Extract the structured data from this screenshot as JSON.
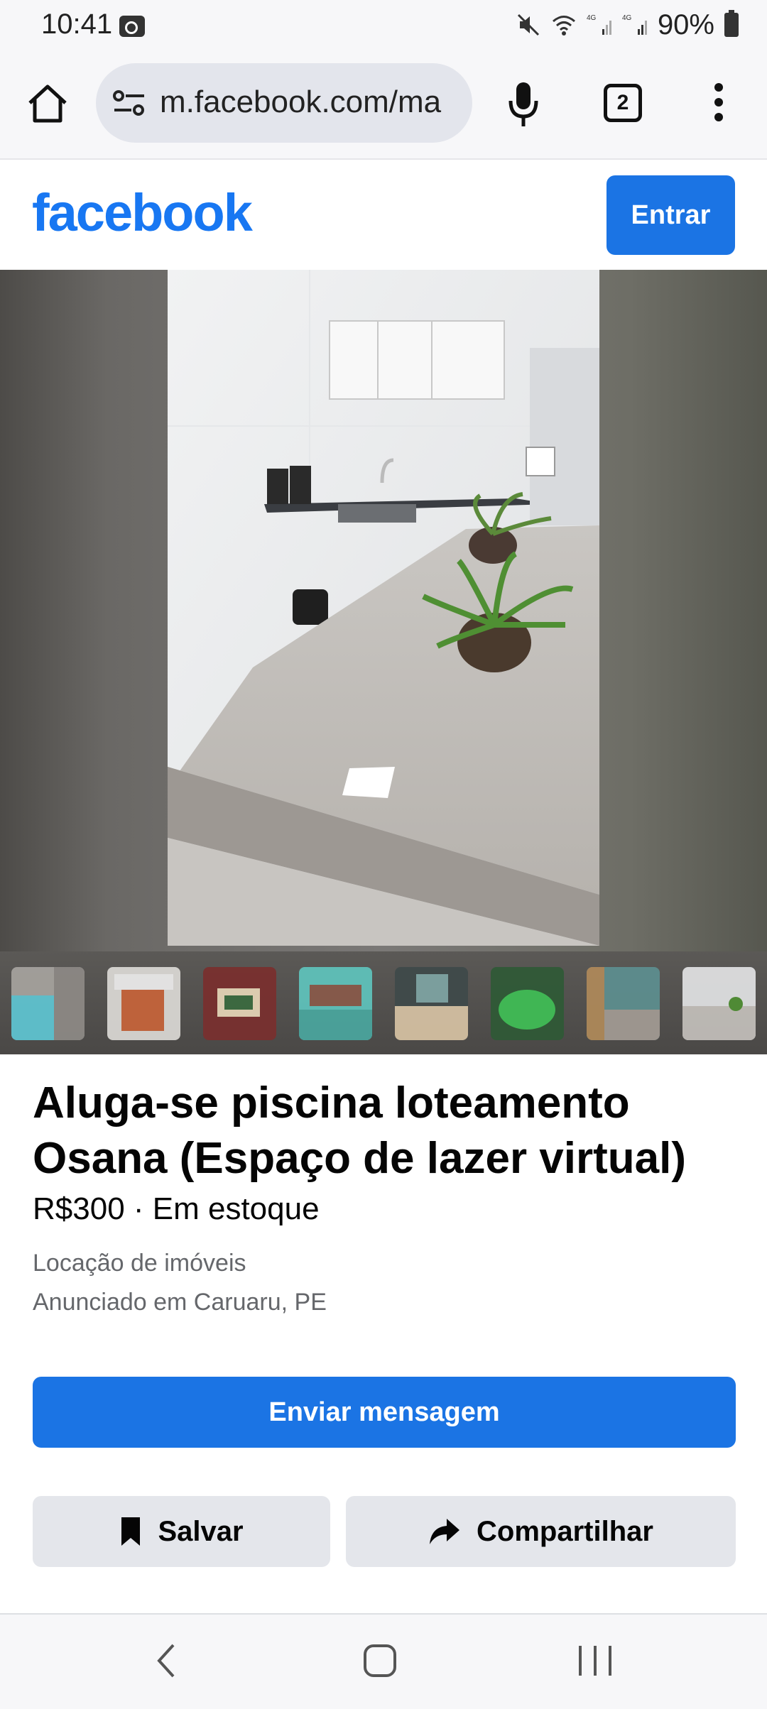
{
  "status_bar": {
    "time": "10:41",
    "battery": "90%",
    "network_label": "4G"
  },
  "browser": {
    "url": "m.facebook.com/ma",
    "tab_count": "2"
  },
  "header": {
    "logo": "facebook",
    "login_label": "Entrar"
  },
  "listing": {
    "title": "Aluga-se piscina loteamento Osana (Espaço de lazer virtual)",
    "price_line": "R$300 · Em estoque",
    "category": "Locação de imóveis",
    "location": "Anunciado em Caruaru, PE",
    "thumbnail_count": 8
  },
  "actions": {
    "message_label": "Enviar mensagem",
    "save_label": "Salvar",
    "share_label": "Compartilhar"
  },
  "colors": {
    "brand": "#1877f2",
    "button_primary": "#1b74e4",
    "button_secondary": "#e4e6eb",
    "secondary_text": "#65676b"
  }
}
